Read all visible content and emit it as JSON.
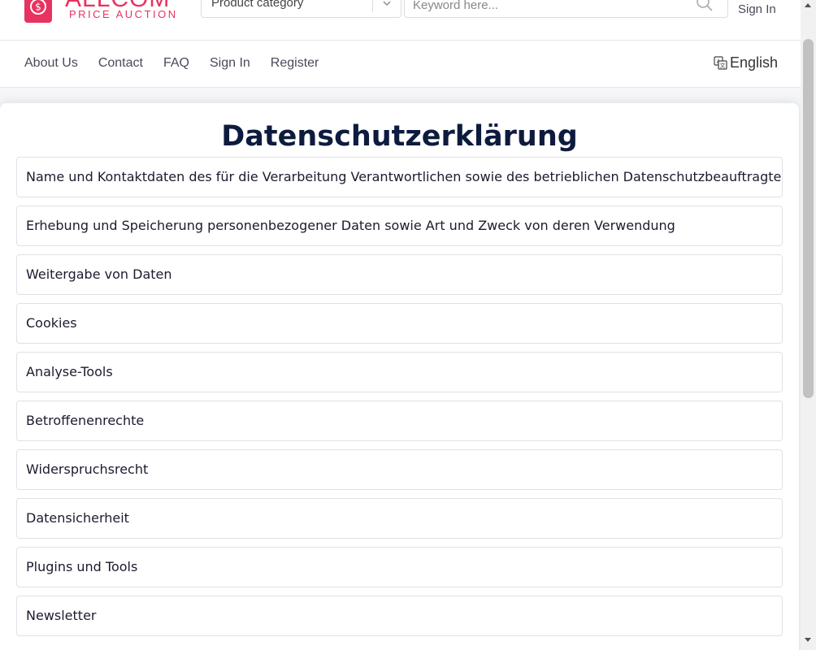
{
  "header": {
    "logo": {
      "brand": "ALLCOM",
      "tagline": "PRICE AUCTION"
    },
    "category_select": {
      "value": "Product category"
    },
    "search": {
      "placeholder": "Keyword here..."
    },
    "sign_in": "Sign In"
  },
  "nav": {
    "links": [
      {
        "label": "About Us"
      },
      {
        "label": "Contact"
      },
      {
        "label": "FAQ"
      },
      {
        "label": "Sign In"
      },
      {
        "label": "Register"
      }
    ],
    "language": "English"
  },
  "main": {
    "title": "Datenschutzerklärung",
    "sections": [
      {
        "label": "Name und Kontaktdaten des für die Verarbeitung Verantwortlichen sowie des betrieblichen Datenschutzbeauftragten"
      },
      {
        "label": "Erhebung und Speicherung personenbezogener Daten sowie Art und Zweck von deren Verwendung"
      },
      {
        "label": "Weitergabe von Daten"
      },
      {
        "label": "Cookies"
      },
      {
        "label": "Analyse-Tools"
      },
      {
        "label": "Betroffenenrechte"
      },
      {
        "label": "Widerspruchsrecht"
      },
      {
        "label": "Datensicherheit"
      },
      {
        "label": "Plugins und Tools"
      },
      {
        "label": "Newsletter"
      }
    ]
  },
  "colors": {
    "brand": "#e8325f",
    "title": "#0d1b3e",
    "text": "#1b1b2f",
    "border": "#dfe1e5"
  },
  "icons": {
    "logo": "dollar-coin-icon",
    "dropdown": "chevron-down-icon",
    "search": "search-icon",
    "language": "translate-icon"
  }
}
